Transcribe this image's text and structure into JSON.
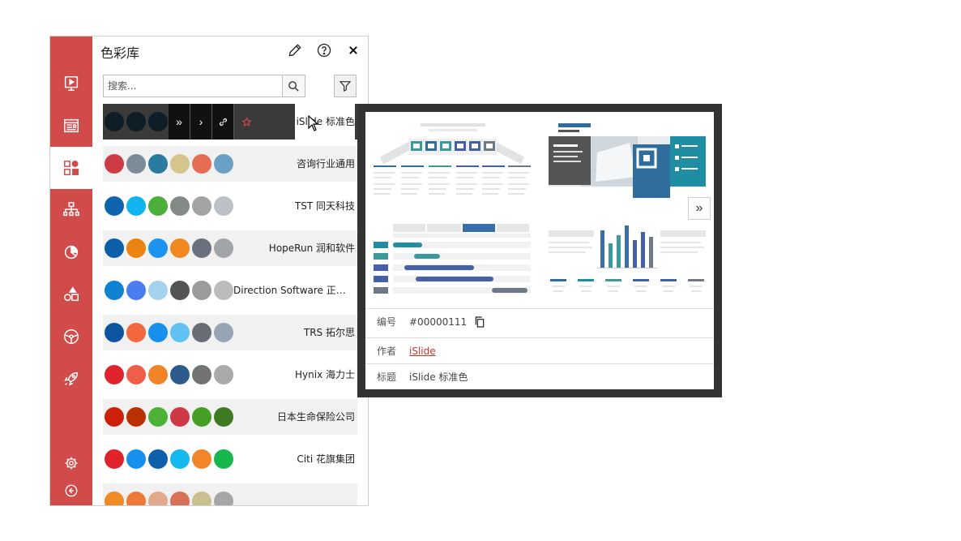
{
  "panel": {
    "title": "色彩库",
    "search_placeholder": "搜索..."
  },
  "rail": {
    "items": [
      {
        "icon": "slideshow-icon"
      },
      {
        "icon": "layout-icon"
      },
      {
        "icon": "color-library-icon",
        "active": true
      },
      {
        "icon": "diagram-icon"
      },
      {
        "icon": "chart-icon"
      },
      {
        "icon": "shapes-icon"
      },
      {
        "icon": "steering-icon"
      },
      {
        "icon": "rocket-icon"
      }
    ],
    "bottom": [
      {
        "icon": "settings-icon"
      },
      {
        "icon": "collapse-icon"
      }
    ]
  },
  "palettes": [
    {
      "name": "iSlide 标准色",
      "colors": [
        "#0f1d26",
        "#0f1d26",
        "#0f1d26",
        "#111111",
        "#111111",
        "#111111"
      ],
      "hover": true
    },
    {
      "name": "咨询行业通用",
      "colors": [
        "#cd3c44",
        "#7b8c98",
        "#2b7ba0",
        "#d6c48e",
        "#e56d53",
        "#6aa0c4"
      ]
    },
    {
      "name": "TST 同天科技",
      "colors": [
        "#0f64b0",
        "#12b4ee",
        "#4cae3b",
        "#848a86",
        "#a1a3a5",
        "#bcc1c7"
      ]
    },
    {
      "name": "HopeRun 润和软件",
      "colors": [
        "#0b5ea9",
        "#ed8310",
        "#1a94ef",
        "#f0871f",
        "#68717d",
        "#a1a4a9"
      ]
    },
    {
      "name": "Direction Software 正方软件",
      "colors": [
        "#1181d2",
        "#4a7ef0",
        "#a3d3ef",
        "#545656",
        "#9a9b9a",
        "#b9bbbd"
      ]
    },
    {
      "name": "TRS 拓尔思",
      "colors": [
        "#0d55a0",
        "#f2673e",
        "#1690ec",
        "#60c1f3",
        "#686d76",
        "#97a4b4"
      ]
    },
    {
      "name": "Hynix 海力士",
      "colors": [
        "#e0242d",
        "#ee5e48",
        "#f18428",
        "#2d5c8c",
        "#727373",
        "#a8aaab"
      ]
    },
    {
      "name": "日本生命保险公司",
      "colors": [
        "#cc2009",
        "#b93100",
        "#4db138",
        "#cf3844",
        "#469e26",
        "#3e7a21"
      ]
    },
    {
      "name": "Citi 花旗集团",
      "colors": [
        "#e0222b",
        "#1690ec",
        "#0e60aa",
        "#14b9ef",
        "#f18527",
        "#17b74d"
      ]
    },
    {
      "name": "",
      "colors": [
        "#f08a24",
        "#ee7a38",
        "#e3a98c",
        "#d9705a",
        "#c9c08f",
        "#a6a6a6"
      ]
    }
  ],
  "preview": {
    "next_label": "»",
    "id_label": "编号",
    "id_value": "#00000111",
    "author_label": "作者",
    "author_value": "iSlide",
    "title_label": "标题",
    "title_value": "iSlide 标准色"
  }
}
